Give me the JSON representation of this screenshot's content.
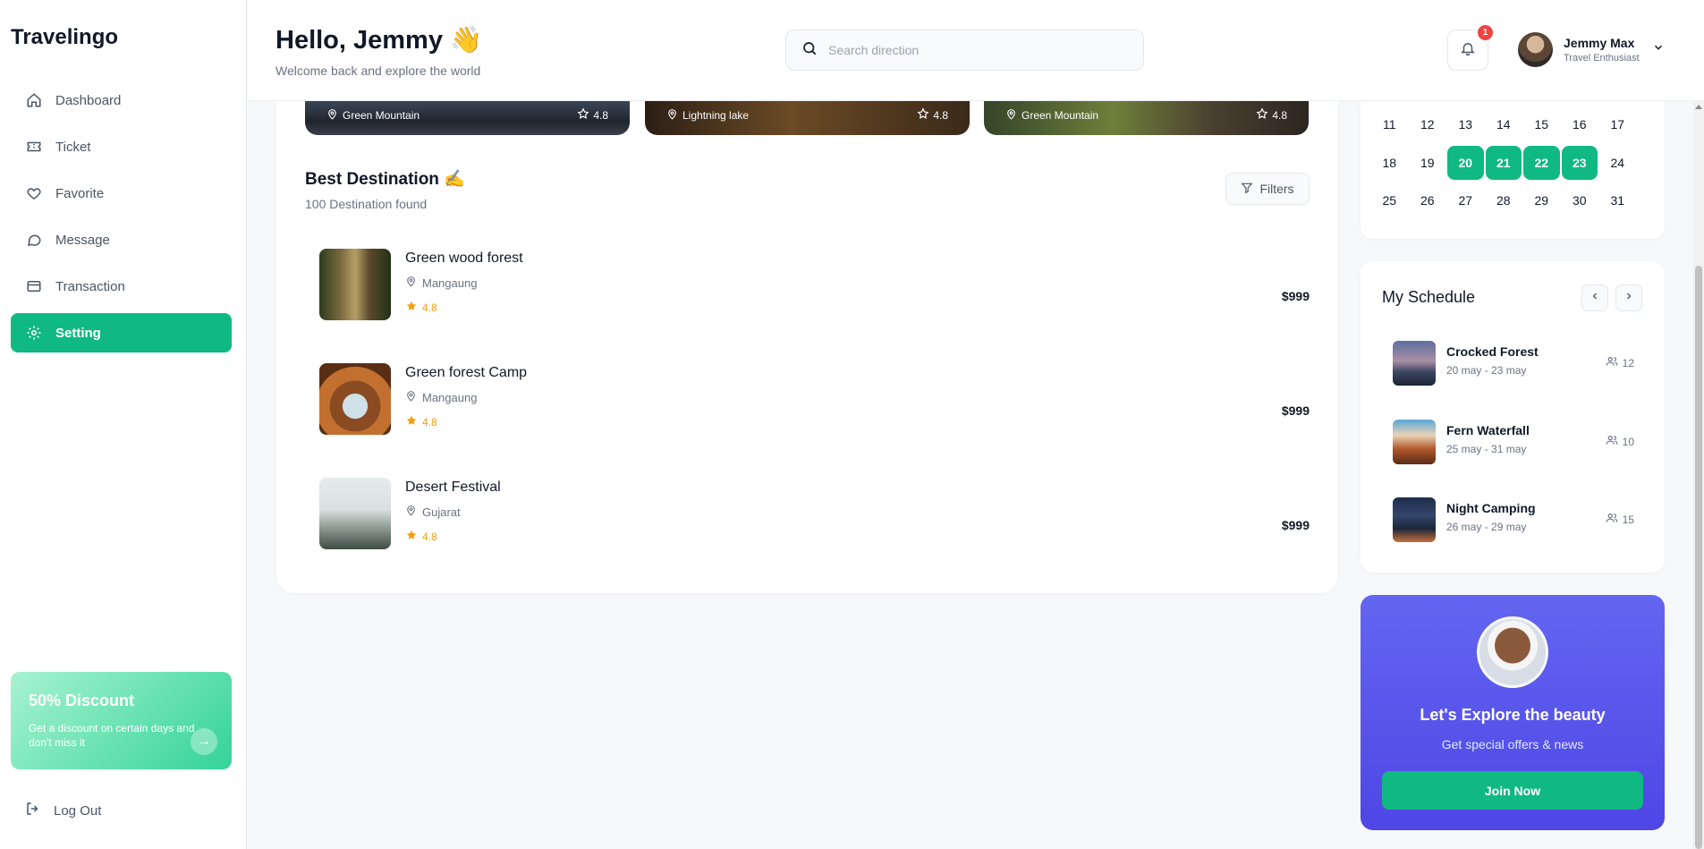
{
  "brand": "Travelingo",
  "sidebar": {
    "items": [
      {
        "label": "Dashboard",
        "icon": "home-icon"
      },
      {
        "label": "Ticket",
        "icon": "ticket-icon"
      },
      {
        "label": "Favorite",
        "icon": "heart-icon"
      },
      {
        "label": "Message",
        "icon": "message-icon"
      },
      {
        "label": "Transaction",
        "icon": "card-icon"
      },
      {
        "label": "Setting",
        "icon": "gear-icon",
        "active": true
      }
    ],
    "promo": {
      "title": "50% Discount",
      "text": "Get a discount on certain days and don't miss it",
      "arrow": "→"
    },
    "logout": "Log Out"
  },
  "header": {
    "greeting": "Hello, Jemmy 👋",
    "subtitle": "Welcome back and explore the world",
    "search_placeholder": "Search direction",
    "notification_count": "1",
    "user": {
      "name": "Jemmy Max",
      "role": "Travel Enthusiast"
    }
  },
  "featured": [
    {
      "location": "Green Mountain",
      "rating": "4.8"
    },
    {
      "location": "Lightning lake",
      "rating": "4.8"
    },
    {
      "location": "Green Mountain",
      "rating": "4.8"
    }
  ],
  "best_destination": {
    "title": "Best Destination ✍️",
    "count": "100 Destination found",
    "filters_label": "Filters",
    "items": [
      {
        "name": "Green wood forest",
        "place": "Mangaung",
        "rating": "4.8",
        "price": "$999"
      },
      {
        "name": "Green forest Camp",
        "place": "Mangaung",
        "rating": "4.8",
        "price": "$999"
      },
      {
        "name": "Desert Festival",
        "place": "Gujarat",
        "rating": "4.8",
        "price": "$999"
      }
    ]
  },
  "calendar": {
    "weeks": [
      [
        "11",
        "12",
        "13",
        "14",
        "15",
        "16",
        "17"
      ],
      [
        "18",
        "19",
        "20",
        "21",
        "22",
        "23",
        "24"
      ],
      [
        "25",
        "26",
        "27",
        "28",
        "29",
        "30",
        "31"
      ]
    ],
    "selected": [
      "20",
      "21",
      "22",
      "23"
    ]
  },
  "schedule": {
    "title": "My Schedule",
    "items": [
      {
        "name": "Crocked Forest",
        "date": "20 may - 23 may",
        "count": "12"
      },
      {
        "name": "Fern Waterfall",
        "date": "25 may - 31 may",
        "count": "10"
      },
      {
        "name": "Night Camping",
        "date": "26 may - 29 may",
        "count": "15"
      }
    ]
  },
  "explore": {
    "title": "Let's Explore the beauty",
    "subtitle": "Get special offers & news",
    "button": "Join Now"
  },
  "colors": {
    "accent": "#10b981",
    "purple": "#4f46e5",
    "badge": "#ef4444",
    "star": "#f59e0b"
  }
}
